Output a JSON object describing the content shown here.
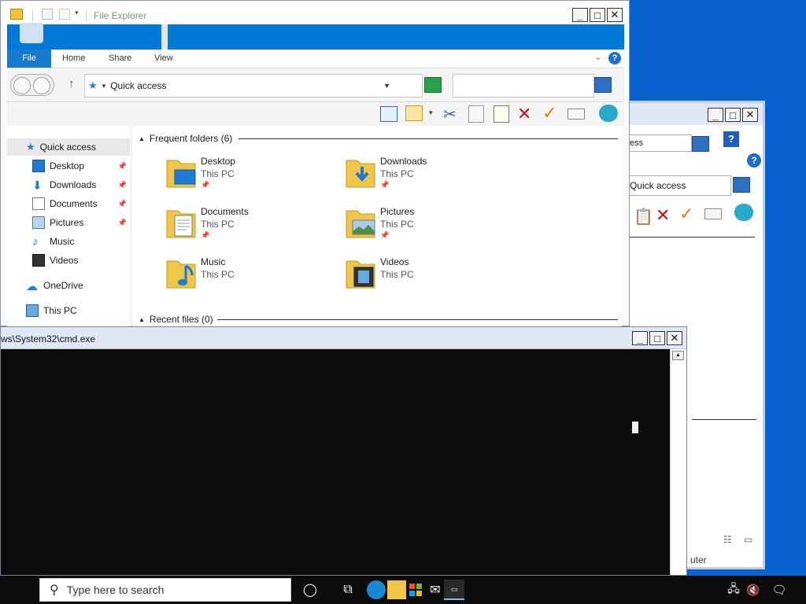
{
  "explorer": {
    "title": "File Explorer",
    "tabs": [
      "File",
      "Home",
      "Share",
      "View"
    ],
    "address": "Quick access",
    "search_placeholder": "",
    "nav": [
      {
        "label": "Quick access",
        "pinned": false
      },
      {
        "label": "Desktop",
        "pinned": true
      },
      {
        "label": "Downloads",
        "pinned": true
      },
      {
        "label": "Documents",
        "pinned": true
      },
      {
        "label": "Pictures",
        "pinned": true
      },
      {
        "label": "Music",
        "pinned": false
      },
      {
        "label": "Videos",
        "pinned": false
      },
      {
        "label": "OneDrive",
        "pinned": false
      },
      {
        "label": "This PC",
        "pinned": false
      }
    ],
    "frequent_header": "Frequent folders (6)",
    "recent_header": "Recent files (0)",
    "folders": [
      {
        "name": "Desktop",
        "location": "This PC"
      },
      {
        "name": "Downloads",
        "location": "This PC"
      },
      {
        "name": "Documents",
        "location": "This PC"
      },
      {
        "name": "Pictures",
        "location": "This PC"
      },
      {
        "name": "Music",
        "location": "This PC"
      },
      {
        "name": "Videos",
        "location": "This PC"
      }
    ]
  },
  "back_window": {
    "address_fragment": "ess",
    "quick_access": "Quick access",
    "status_fragment": "uter"
  },
  "cmd": {
    "title": "ws\\System32\\cmd.exe"
  },
  "taskbar": {
    "search_placeholder": "Type here to search"
  },
  "colors": {
    "ribbon_blue": "#0078d7",
    "desktop_blue": "#0a62cf",
    "cmd_bg": "#0c0c0c",
    "folder_yellow": "#f0c64a"
  }
}
